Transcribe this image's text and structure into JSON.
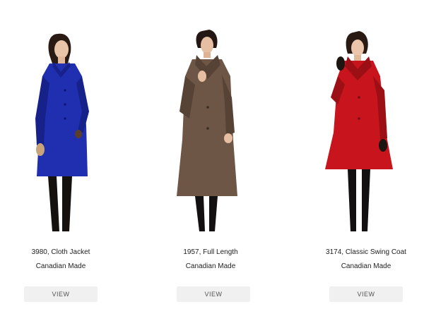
{
  "products": [
    {
      "title": "3980, Cloth Jacket",
      "origin": "Canadian Made",
      "button_label": "VIEW",
      "coat_color": "#1f2fb0",
      "coat_shade": "#16228a"
    },
    {
      "title": "1957, Full Length",
      "origin": "Canadian Made",
      "button_label": "VIEW",
      "coat_color": "#6e5646",
      "coat_shade": "#574335"
    },
    {
      "title": "3174, Classic Swing Coat",
      "origin": "Canadian Made",
      "button_label": "VIEW",
      "coat_color": "#c8141c",
      "coat_shade": "#9c0f15"
    }
  ]
}
